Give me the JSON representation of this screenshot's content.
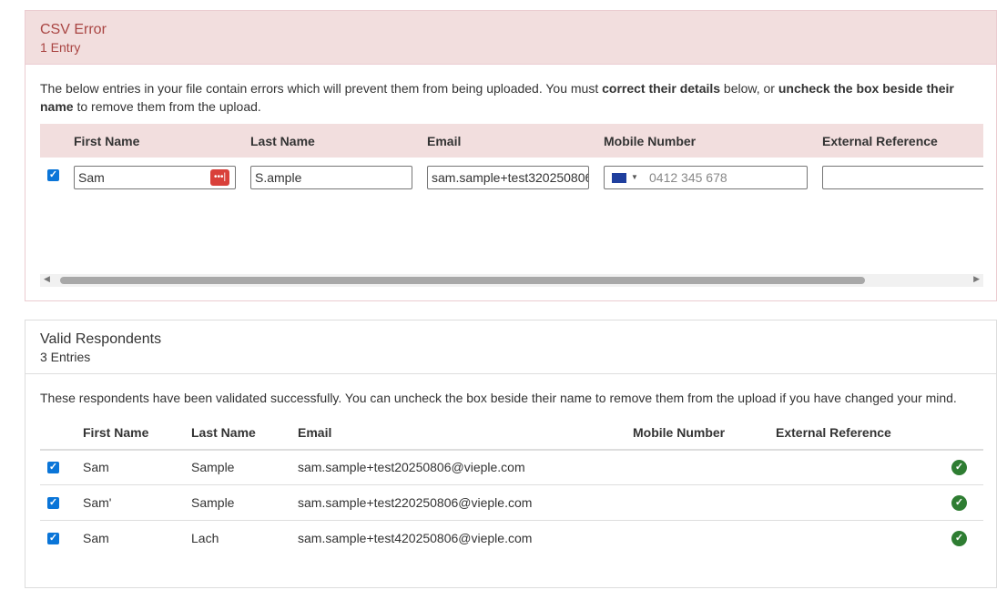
{
  "error_panel": {
    "title": "CSV Error",
    "count": "1 Entry",
    "desc_1": "The below entries in your file contain errors which will prevent them from being uploaded. You must ",
    "desc_b1": "correct their details",
    "desc_2": " below, or ",
    "desc_b2": "uncheck the box beside their name",
    "desc_3": " to remove them from the upload.",
    "headers": [
      "First Name",
      "Last Name",
      "Email",
      "Mobile Number",
      "External Reference"
    ],
    "row": {
      "first_name": "Sam",
      "last_name": "S.ample",
      "email": "sam.sample+test320250806",
      "mobile_placeholder": "0412 345 678",
      "external_reference": ""
    }
  },
  "valid_panel": {
    "title": "Valid Respondents",
    "count": "3 Entries",
    "desc": "These respondents have been validated successfully. You can uncheck the box beside their name to remove them from the upload if you have changed your mind.",
    "headers": [
      "First Name",
      "Last Name",
      "Email",
      "Mobile Number",
      "External Reference"
    ],
    "rows": [
      {
        "first_name": "Sam",
        "last_name": "Sample",
        "email": "sam.sample+test20250806@vieple.com"
      },
      {
        "first_name": "Sam'",
        "last_name": "Sample",
        "email": "sam.sample+test220250806@vieple.com"
      },
      {
        "first_name": "Sam",
        "last_name": "Lach",
        "email": "sam.sample+test420250806@vieple.com"
      }
    ]
  },
  "colors": {
    "error_bg": "#f2dede",
    "error_text": "#a94442",
    "checkbox": "#0a75d8",
    "success": "#2e7d32"
  }
}
